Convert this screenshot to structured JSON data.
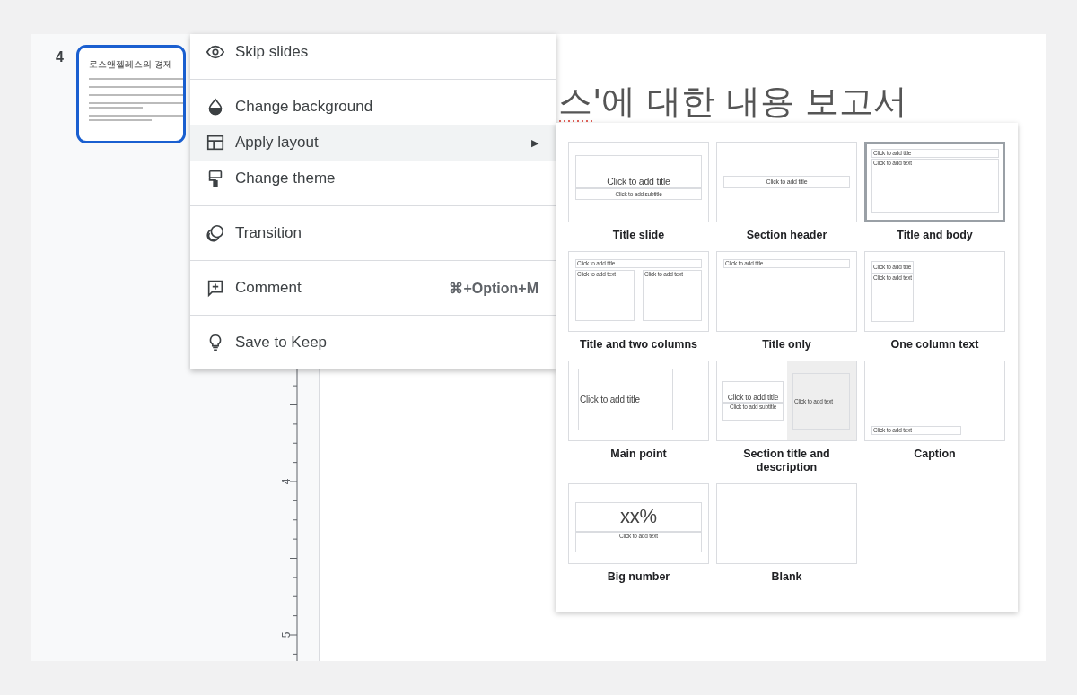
{
  "filmstrip": {
    "slide_number": "4",
    "slide_title": "로스앤젤레스의 경제",
    "selected": true
  },
  "ruler": {
    "labels": [
      "4",
      "5"
    ]
  },
  "slide": {
    "title": "스'에 대한 내용 보고서"
  },
  "context_menu": [
    {
      "kind": "item",
      "label": "Skip slides",
      "selected": false
    },
    {
      "kind": "divider"
    },
    {
      "kind": "item",
      "label": "Change background",
      "selected": false
    },
    {
      "kind": "item",
      "label": "Apply layout",
      "selected": true,
      "submenu_arrow": "▶"
    },
    {
      "kind": "item",
      "label": "Change theme",
      "selected": false
    },
    {
      "kind": "divider"
    },
    {
      "kind": "item",
      "label": "Transition",
      "selected": false
    },
    {
      "kind": "divider"
    },
    {
      "kind": "item",
      "label": "Comment",
      "selected": false,
      "shortcut": "⌘+Option+M"
    },
    {
      "kind": "divider"
    },
    {
      "kind": "item",
      "label": "Save to Keep",
      "selected": false
    }
  ],
  "layouts": [
    {
      "kind": "title_slide",
      "label": "Title slide",
      "selected": false,
      "placeholders": [
        "Click to add title",
        "Click to add subtitle"
      ]
    },
    {
      "kind": "section_header",
      "label": "Section header",
      "selected": false,
      "placeholders": [
        "Click to add title"
      ]
    },
    {
      "kind": "title_body",
      "label": "Title and body",
      "selected": true,
      "placeholders": [
        "Click to add title",
        "Click to add text"
      ]
    },
    {
      "kind": "two_columns",
      "label": "Title and two columns",
      "selected": false,
      "placeholders": [
        "Click to add title",
        "Click to add text",
        "Click to add text"
      ]
    },
    {
      "kind": "title_only",
      "label": "Title only",
      "selected": false,
      "placeholders": [
        "Click to add title"
      ]
    },
    {
      "kind": "one_column",
      "label": "One column text",
      "selected": false,
      "placeholders": [
        "Click to add title",
        "Click to add text"
      ]
    },
    {
      "kind": "main_point",
      "label": "Main point",
      "selected": false,
      "placeholders": [
        "Click to add title"
      ]
    },
    {
      "kind": "section_description",
      "label": "Section title and description",
      "selected": false,
      "placeholders": [
        "Click to add title",
        "Click to add subtitle",
        "Click to add text"
      ]
    },
    {
      "kind": "caption",
      "label": "Caption",
      "selected": false,
      "placeholders": [
        "Click to add text"
      ]
    },
    {
      "kind": "big_number",
      "label": "Big number",
      "selected": false,
      "placeholders": [
        "xx%",
        "Click to add text"
      ]
    },
    {
      "kind": "blank",
      "label": "Blank",
      "selected": false
    }
  ]
}
